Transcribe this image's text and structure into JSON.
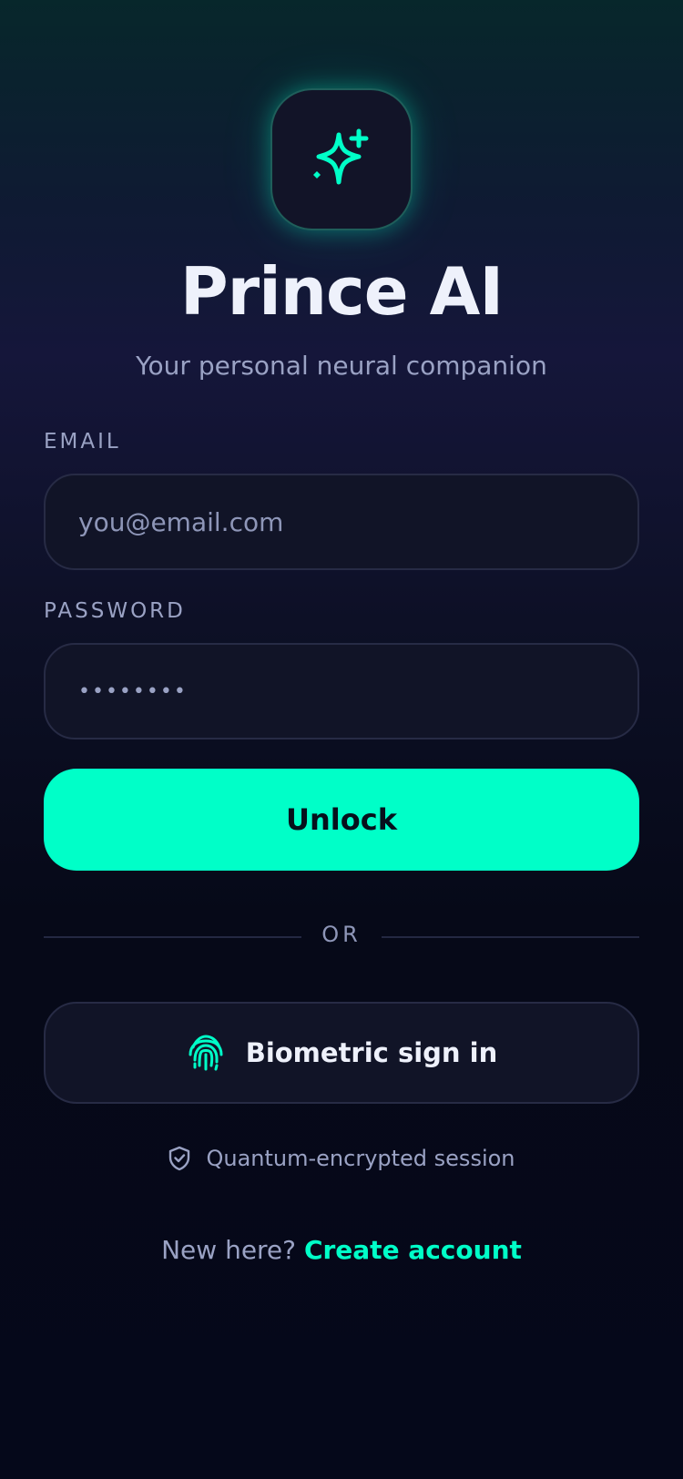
{
  "app": {
    "title": "Prince AI",
    "subtitle": "Your personal neural companion",
    "logo_icon": "sparkles-icon"
  },
  "email": {
    "label": "EMAIL",
    "placeholder": "you@email.com",
    "value": ""
  },
  "password": {
    "label": "PASSWORD",
    "value": "••••••••"
  },
  "unlock_button": {
    "label": "Unlock"
  },
  "divider": {
    "text": "OR"
  },
  "biometric": {
    "label": "Biometric sign in",
    "icon": "fingerprint-icon"
  },
  "security": {
    "text": "Quantum-encrypted session",
    "icon": "shield-check-icon"
  },
  "signup": {
    "prompt": "New here?",
    "link": "Create account"
  },
  "colors": {
    "accent": "#00ffc8",
    "background": "#05081a",
    "surface": "#111427",
    "muted_text": "#9aa2c4"
  }
}
